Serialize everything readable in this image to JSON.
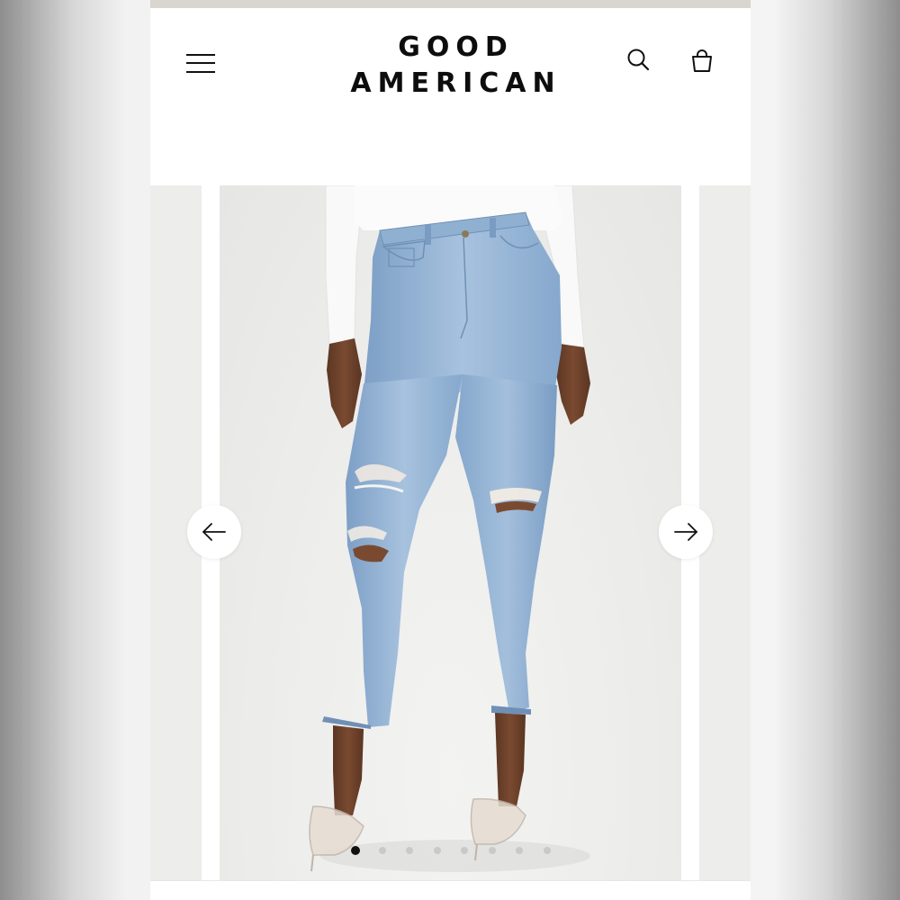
{
  "header": {
    "brand_line1": "GOOD",
    "brand_line2": "AMERICAN",
    "icons": [
      "menu-icon",
      "search-icon",
      "shopping-bag-icon"
    ]
  },
  "gallery": {
    "total_images": 8,
    "current_index": 1,
    "prev_icon": "arrow-left-icon",
    "next_icon": "arrow-right-icon"
  },
  "colors": {
    "denim": "#8fb1d4",
    "brand_text": "#0d0d0d",
    "active_dot": "#111111",
    "inactive_dot": "#c9c9c9"
  }
}
